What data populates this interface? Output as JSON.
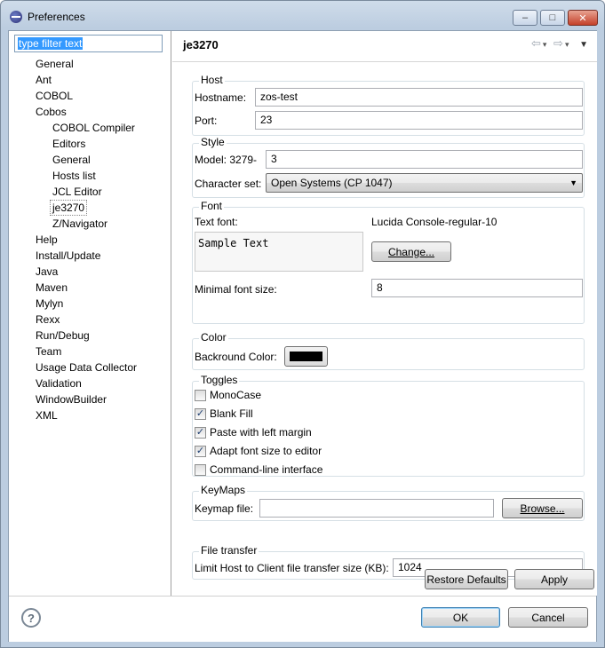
{
  "window": {
    "title": "Preferences",
    "minimize": "–",
    "maximize": "□",
    "close": "✕"
  },
  "filter": {
    "value": "type filter text"
  },
  "tree": [
    {
      "label": "General",
      "level": 0
    },
    {
      "label": "Ant",
      "level": 0
    },
    {
      "label": "COBOL",
      "level": 0
    },
    {
      "label": "Cobos",
      "level": 0
    },
    {
      "label": "COBOL Compiler",
      "level": 1
    },
    {
      "label": "Editors",
      "level": 1
    },
    {
      "label": "General",
      "level": 1
    },
    {
      "label": "Hosts list",
      "level": 1
    },
    {
      "label": "JCL Editor",
      "level": 1
    },
    {
      "label": "je3270",
      "level": 1,
      "selected": true
    },
    {
      "label": "Z/Navigator",
      "level": 1
    },
    {
      "label": "Help",
      "level": 0
    },
    {
      "label": "Install/Update",
      "level": 0
    },
    {
      "label": "Java",
      "level": 0
    },
    {
      "label": "Maven",
      "level": 0
    },
    {
      "label": "Mylyn",
      "level": 0
    },
    {
      "label": "Rexx",
      "level": 0
    },
    {
      "label": "Run/Debug",
      "level": 0
    },
    {
      "label": "Team",
      "level": 0
    },
    {
      "label": "Usage Data Collector",
      "level": 0
    },
    {
      "label": "Validation",
      "level": 0
    },
    {
      "label": "WindowBuilder",
      "level": 0
    },
    {
      "label": "XML",
      "level": 0
    }
  ],
  "page": {
    "title": "je3270",
    "nav": {
      "back": "⇦",
      "forward": "⇨",
      "dropdown": "▾",
      "menu": "▼"
    },
    "host": {
      "legend": "Host",
      "hostname_label": "Hostname:",
      "hostname_value": "zos-test",
      "port_label": "Port:",
      "port_value": "23"
    },
    "style": {
      "legend": "Style",
      "model_label": "Model: 3279-",
      "model_value": "3",
      "charset_label": "Character set:",
      "charset_value": "Open Systems (CP 1047)"
    },
    "font": {
      "legend": "Font",
      "text_font_label": "Text font:",
      "font_name": "Lucida Console-regular-10",
      "sample": "Sample Text",
      "change_button": "Change...",
      "min_size_label": "Minimal font size:",
      "min_size_value": "8"
    },
    "color": {
      "legend": "Color",
      "background_label": "Backround Color:",
      "background_color": "#000000"
    },
    "toggles": {
      "legend": "Toggles",
      "items": [
        {
          "label": "MonoCase",
          "checked": false
        },
        {
          "label": "Blank Fill",
          "checked": true
        },
        {
          "label": "Paste with left margin",
          "checked": true
        },
        {
          "label": "Adapt font size to editor",
          "checked": true
        },
        {
          "label": "Command-line interface",
          "checked": false
        }
      ]
    },
    "keymaps": {
      "legend": "KeyMaps",
      "file_label": "Keymap file:",
      "file_value": "",
      "browse_button": "Browse..."
    },
    "transfer": {
      "legend": "File transfer",
      "limit_label": "Limit Host to Client file transfer size (KB):",
      "limit_value": "1024"
    },
    "restore_button": "Restore Defaults",
    "apply_button": "Apply"
  },
  "footer": {
    "help": "?",
    "ok_button": "OK",
    "cancel_button": "Cancel"
  }
}
